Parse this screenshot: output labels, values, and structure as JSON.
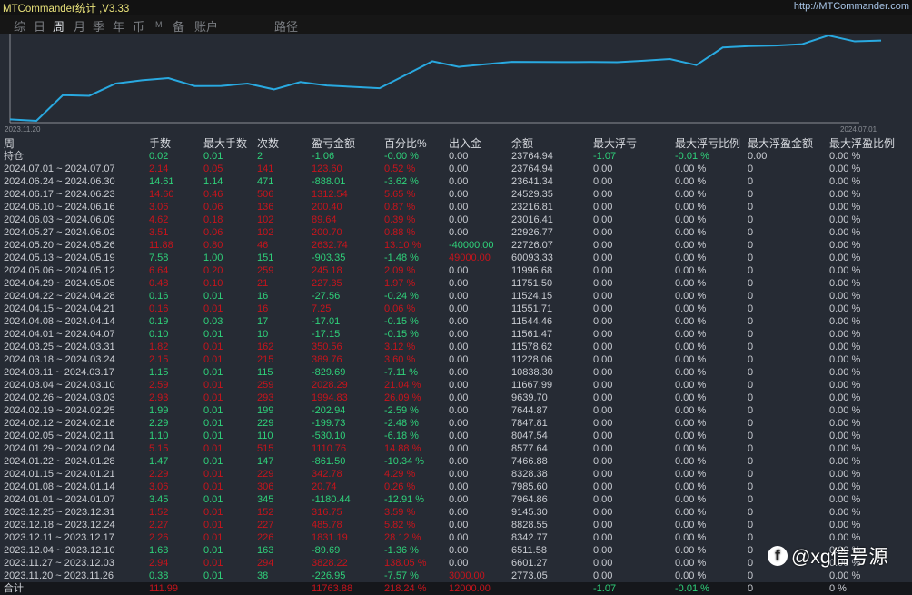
{
  "app": {
    "title": "MTCommander统计 ,V3.33",
    "url": "http://MTCommander.com"
  },
  "tabs": [
    {
      "label": "综",
      "active": false
    },
    {
      "label": "日",
      "active": false
    },
    {
      "label": "周",
      "active": true
    },
    {
      "label": "月",
      "active": false
    },
    {
      "label": "季",
      "active": false
    },
    {
      "label": "年",
      "active": false
    },
    {
      "label": "币",
      "active": false
    },
    {
      "label": "M",
      "active": false
    },
    {
      "label": "备",
      "active": false
    },
    {
      "label": "账户",
      "active": false
    },
    {
      "label": "路径",
      "active": false
    }
  ],
  "chart_data": {
    "type": "line",
    "title": "",
    "x_start_label": "2023.11.20",
    "x_end_label": "2024.07.01",
    "line_color": "#29a9e0",
    "values": [
      0,
      -226.95,
      3601.27,
      3511.58,
      5342.77,
      5828.55,
      6145.3,
      4964.86,
      4985.6,
      5328.38,
      4466.88,
      5577.64,
      5047.54,
      4847.81,
      4644.87,
      6639.7,
      8667.99,
      7838.3,
      8228.06,
      8578.62,
      8561.47,
      8544.46,
      8551.71,
      8524.15,
      8751.5,
      8996.68,
      8093.33,
      10726.07,
      10926.77,
      11016.41,
      11216.81,
      12529.35,
      11641.34,
      11764.94
    ]
  },
  "table": {
    "headers": [
      "周",
      "手数",
      "最大手数",
      "次数",
      "盈亏金额",
      "百分比%",
      "出入金",
      "余额",
      "最大浮亏",
      "最大浮亏比例",
      "最大浮盈金额",
      "最大浮盈比例"
    ],
    "position_row": {
      "cells": [
        "持仓",
        "0.02",
        "0.01",
        "2",
        "-1.06",
        "-0.00 %",
        "0.00",
        "23764.94",
        "-1.07",
        "-0.01 %",
        "0.00",
        "0.00 %"
      ],
      "color": "g"
    },
    "rows": [
      {
        "cells": [
          "2024.07.01 ~ 2024.07.07",
          "2.14",
          "0.05",
          "141",
          "123.60",
          "0.52 %",
          "0.00",
          "23764.94",
          "0.00",
          "0.00 %",
          "0",
          "0.00 %"
        ],
        "color": "r"
      },
      {
        "cells": [
          "2024.06.24 ~ 2024.06.30",
          "14.61",
          "1.14",
          "471",
          "-888.01",
          "-3.62 %",
          "0.00",
          "23641.34",
          "0.00",
          "0.00 %",
          "0",
          "0.00 %"
        ],
        "color": "g"
      },
      {
        "cells": [
          "2024.06.17 ~ 2024.06.23",
          "14.60",
          "0.46",
          "506",
          "1312.54",
          "5.65 %",
          "0.00",
          "24529.35",
          "0.00",
          "0.00 %",
          "0",
          "0.00 %"
        ],
        "color": "r"
      },
      {
        "cells": [
          "2024.06.10 ~ 2024.06.16",
          "3.06",
          "0.06",
          "136",
          "200.40",
          "0.87 %",
          "0.00",
          "23216.81",
          "0.00",
          "0.00 %",
          "0",
          "0.00 %"
        ],
        "color": "r"
      },
      {
        "cells": [
          "2024.06.03 ~ 2024.06.09",
          "4.62",
          "0.18",
          "102",
          "89.64",
          "0.39 %",
          "0.00",
          "23016.41",
          "0.00",
          "0.00 %",
          "0",
          "0.00 %"
        ],
        "color": "r"
      },
      {
        "cells": [
          "2024.05.27 ~ 2024.06.02",
          "3.51",
          "0.06",
          "102",
          "200.70",
          "0.88 %",
          "0.00",
          "22926.77",
          "0.00",
          "0.00 %",
          "0",
          "0.00 %"
        ],
        "color": "r"
      },
      {
        "cells": [
          "2024.05.20 ~ 2024.05.26",
          "11.88",
          "0.80",
          "46",
          "2632.74",
          "13.10 %",
          "-40000.00",
          "22726.07",
          "0.00",
          "0.00 %",
          "0",
          "0.00 %"
        ],
        "color": "r"
      },
      {
        "cells": [
          "2024.05.13 ~ 2024.05.19",
          "7.58",
          "1.00",
          "151",
          "-903.35",
          "-1.48 %",
          "49000.00",
          "60093.33",
          "0.00",
          "0.00 %",
          "0",
          "0.00 %"
        ],
        "color": "g"
      },
      {
        "cells": [
          "2024.05.06 ~ 2024.05.12",
          "6.64",
          "0.20",
          "259",
          "245.18",
          "2.09 %",
          "0.00",
          "11996.68",
          "0.00",
          "0.00 %",
          "0",
          "0.00 %"
        ],
        "color": "r"
      },
      {
        "cells": [
          "2024.04.29 ~ 2024.05.05",
          "0.48",
          "0.10",
          "21",
          "227.35",
          "1.97 %",
          "0.00",
          "11751.50",
          "0.00",
          "0.00 %",
          "0",
          "0.00 %"
        ],
        "color": "r"
      },
      {
        "cells": [
          "2024.04.22 ~ 2024.04.28",
          "0.16",
          "0.01",
          "16",
          "-27.56",
          "-0.24 %",
          "0.00",
          "11524.15",
          "0.00",
          "0.00 %",
          "0",
          "0.00 %"
        ],
        "color": "g"
      },
      {
        "cells": [
          "2024.04.15 ~ 2024.04.21",
          "0.16",
          "0.01",
          "16",
          "7.25",
          "0.06 %",
          "0.00",
          "11551.71",
          "0.00",
          "0.00 %",
          "0",
          "0.00 %"
        ],
        "color": "r"
      },
      {
        "cells": [
          "2024.04.08 ~ 2024.04.14",
          "0.19",
          "0.03",
          "17",
          "-17.01",
          "-0.15 %",
          "0.00",
          "11544.46",
          "0.00",
          "0.00 %",
          "0",
          "0.00 %"
        ],
        "color": "g"
      },
      {
        "cells": [
          "2024.04.01 ~ 2024.04.07",
          "0.10",
          "0.01",
          "10",
          "-17.15",
          "-0.15 %",
          "0.00",
          "11561.47",
          "0.00",
          "0.00 %",
          "0",
          "0.00 %"
        ],
        "color": "g"
      },
      {
        "cells": [
          "2024.03.25 ~ 2024.03.31",
          "1.82",
          "0.01",
          "162",
          "350.56",
          "3.12 %",
          "0.00",
          "11578.62",
          "0.00",
          "0.00 %",
          "0",
          "0.00 %"
        ],
        "color": "r"
      },
      {
        "cells": [
          "2024.03.18 ~ 2024.03.24",
          "2.15",
          "0.01",
          "215",
          "389.76",
          "3.60 %",
          "0.00",
          "11228.06",
          "0.00",
          "0.00 %",
          "0",
          "0.00 %"
        ],
        "color": "r"
      },
      {
        "cells": [
          "2024.03.11 ~ 2024.03.17",
          "1.15",
          "0.01",
          "115",
          "-829.69",
          "-7.11 %",
          "0.00",
          "10838.30",
          "0.00",
          "0.00 %",
          "0",
          "0.00 %"
        ],
        "color": "g"
      },
      {
        "cells": [
          "2024.03.04 ~ 2024.03.10",
          "2.59",
          "0.01",
          "259",
          "2028.29",
          "21.04 %",
          "0.00",
          "11667.99",
          "0.00",
          "0.00 %",
          "0",
          "0.00 %"
        ],
        "color": "r"
      },
      {
        "cells": [
          "2024.02.26 ~ 2024.03.03",
          "2.93",
          "0.01",
          "293",
          "1994.83",
          "26.09 %",
          "0.00",
          "9639.70",
          "0.00",
          "0.00 %",
          "0",
          "0.00 %"
        ],
        "color": "r"
      },
      {
        "cells": [
          "2024.02.19 ~ 2024.02.25",
          "1.99",
          "0.01",
          "199",
          "-202.94",
          "-2.59 %",
          "0.00",
          "7644.87",
          "0.00",
          "0.00 %",
          "0",
          "0.00 %"
        ],
        "color": "g"
      },
      {
        "cells": [
          "2024.02.12 ~ 2024.02.18",
          "2.29",
          "0.01",
          "229",
          "-199.73",
          "-2.48 %",
          "0.00",
          "7847.81",
          "0.00",
          "0.00 %",
          "0",
          "0.00 %"
        ],
        "color": "g"
      },
      {
        "cells": [
          "2024.02.05 ~ 2024.02.11",
          "1.10",
          "0.01",
          "110",
          "-530.10",
          "-6.18 %",
          "0.00",
          "8047.54",
          "0.00",
          "0.00 %",
          "0",
          "0.00 %"
        ],
        "color": "g"
      },
      {
        "cells": [
          "2024.01.29 ~ 2024.02.04",
          "5.15",
          "0.01",
          "515",
          "1110.76",
          "14.88 %",
          "0.00",
          "8577.64",
          "0.00",
          "0.00 %",
          "0",
          "0.00 %"
        ],
        "color": "r"
      },
      {
        "cells": [
          "2024.01.22 ~ 2024.01.28",
          "1.47",
          "0.01",
          "147",
          "-861.50",
          "-10.34 %",
          "0.00",
          "7466.88",
          "0.00",
          "0.00 %",
          "0",
          "0.00 %"
        ],
        "color": "g"
      },
      {
        "cells": [
          "2024.01.15 ~ 2024.01.21",
          "2.29",
          "0.01",
          "229",
          "342.78",
          "4.29 %",
          "0.00",
          "8328.38",
          "0.00",
          "0.00 %",
          "0",
          "0.00 %"
        ],
        "color": "r"
      },
      {
        "cells": [
          "2024.01.08 ~ 2024.01.14",
          "3.06",
          "0.01",
          "306",
          "20.74",
          "0.26 %",
          "0.00",
          "7985.60",
          "0.00",
          "0.00 %",
          "0",
          "0.00 %"
        ],
        "color": "r"
      },
      {
        "cells": [
          "2024.01.01 ~ 2024.01.07",
          "3.45",
          "0.01",
          "345",
          "-1180.44",
          "-12.91 %",
          "0.00",
          "7964.86",
          "0.00",
          "0.00 %",
          "0",
          "0.00 %"
        ],
        "color": "g"
      },
      {
        "cells": [
          "2023.12.25 ~ 2023.12.31",
          "1.52",
          "0.01",
          "152",
          "316.75",
          "3.59 %",
          "0.00",
          "9145.30",
          "0.00",
          "0.00 %",
          "0",
          "0.00 %"
        ],
        "color": "r"
      },
      {
        "cells": [
          "2023.12.18 ~ 2023.12.24",
          "2.27",
          "0.01",
          "227",
          "485.78",
          "5.82 %",
          "0.00",
          "8828.55",
          "0.00",
          "0.00 %",
          "0",
          "0.00 %"
        ],
        "color": "r"
      },
      {
        "cells": [
          "2023.12.11 ~ 2023.12.17",
          "2.26",
          "0.01",
          "226",
          "1831.19",
          "28.12 %",
          "0.00",
          "8342.77",
          "0.00",
          "0.00 %",
          "0",
          "0.00 %"
        ],
        "color": "r"
      },
      {
        "cells": [
          "2023.12.04 ~ 2023.12.10",
          "1.63",
          "0.01",
          "163",
          "-89.69",
          "-1.36 %",
          "0.00",
          "6511.58",
          "0.00",
          "0.00 %",
          "0",
          "0.00 %"
        ],
        "color": "g"
      },
      {
        "cells": [
          "2023.11.27 ~ 2023.12.03",
          "2.94",
          "0.01",
          "294",
          "3828.22",
          "138.05 %",
          "0.00",
          "6601.27",
          "0.00",
          "0.00 %",
          "0",
          "0.00 %"
        ],
        "color": "r"
      },
      {
        "cells": [
          "2023.11.20 ~ 2023.11.26",
          "0.38",
          "0.01",
          "38",
          "-226.95",
          "-7.57 %",
          "3000.00",
          "2773.05",
          "0.00",
          "0.00 %",
          "0",
          "0.00 %"
        ],
        "color": "g"
      }
    ],
    "total_row": {
      "cells": [
        "合计",
        "111.99",
        "",
        "",
        "11763.88",
        "218.24 %",
        "12000.00",
        "",
        "-1.07",
        "-0.01 %",
        "0",
        "0 %"
      ]
    }
  },
  "colors": {
    "profit": "#c8141c",
    "loss": "#2fd17a",
    "line": "#29a9e0",
    "background": "#262b34"
  },
  "watermark": {
    "icon": "facebook-like-icon",
    "text": "@xg信号源"
  }
}
